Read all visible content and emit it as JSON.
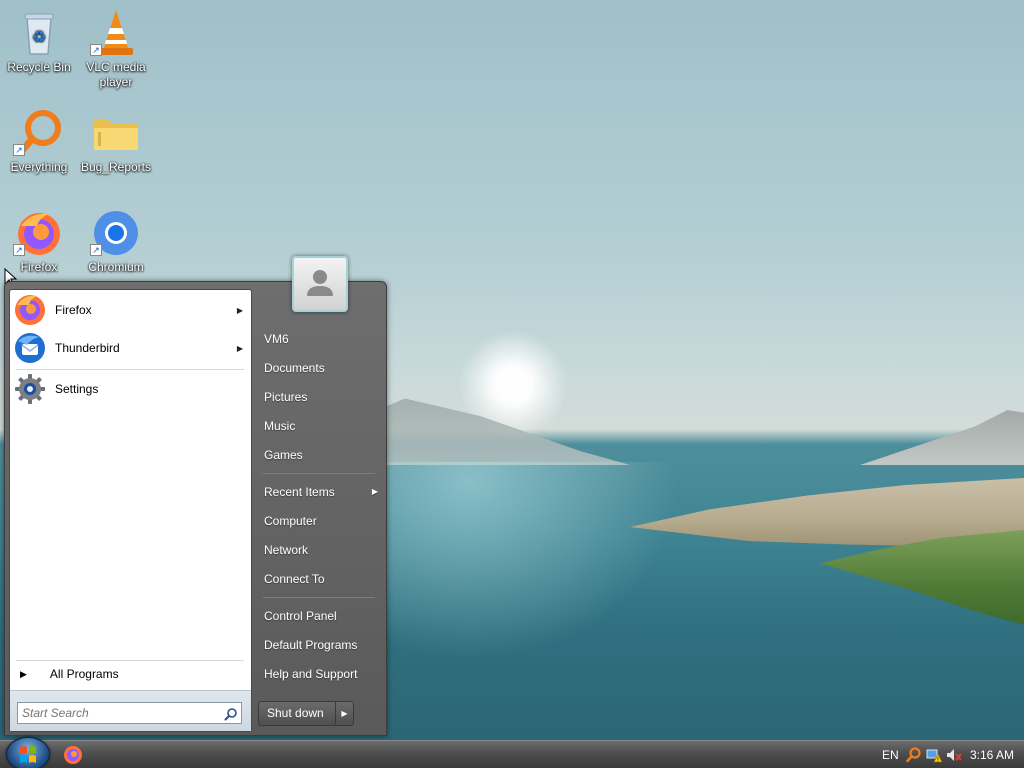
{
  "desktop": {
    "icons": [
      {
        "label": "Recycle Bin",
        "icon": "recycle-bin-icon"
      },
      {
        "label": "VLC media player",
        "icon": "vlc-icon"
      },
      {
        "label": "Everything",
        "icon": "everything-search-icon"
      },
      {
        "label": "Bug_Reports",
        "icon": "folder-icon"
      },
      {
        "label": "Firefox",
        "icon": "firefox-icon"
      },
      {
        "label": "Chromium",
        "icon": "chromium-icon"
      }
    ]
  },
  "start_menu": {
    "pinned": [
      {
        "label": "Firefox",
        "icon": "firefox-icon",
        "has_submenu": true
      },
      {
        "label": "Thunderbird",
        "icon": "thunderbird-icon",
        "has_submenu": true
      },
      {
        "label": "Settings",
        "icon": "gear-icon",
        "has_submenu": false
      }
    ],
    "all_programs": "All Programs",
    "search_placeholder": "Start Search",
    "right_items": [
      {
        "label": "VM6"
      },
      {
        "label": "Documents"
      },
      {
        "label": "Pictures"
      },
      {
        "label": "Music"
      },
      {
        "label": "Games"
      },
      {
        "label": "Recent Items",
        "has_submenu": true
      },
      {
        "label": "Computer"
      },
      {
        "label": "Network"
      },
      {
        "label": "Connect To"
      },
      {
        "label": "Control Panel"
      },
      {
        "label": "Default Programs"
      },
      {
        "label": "Help and Support"
      }
    ],
    "shutdown_label": "Shut down"
  },
  "taskbar": {
    "language": "EN",
    "clock": "3:16 AM",
    "tray_icons": [
      "everything-search-icon",
      "network-warning-icon",
      "volume-muted-icon"
    ]
  },
  "colors": {
    "menu_frame": "#5f5f5f",
    "taskbar": "#4a4a4a",
    "firefox_orange": "#ff7139",
    "chromium_blue": "#1a73e8"
  }
}
